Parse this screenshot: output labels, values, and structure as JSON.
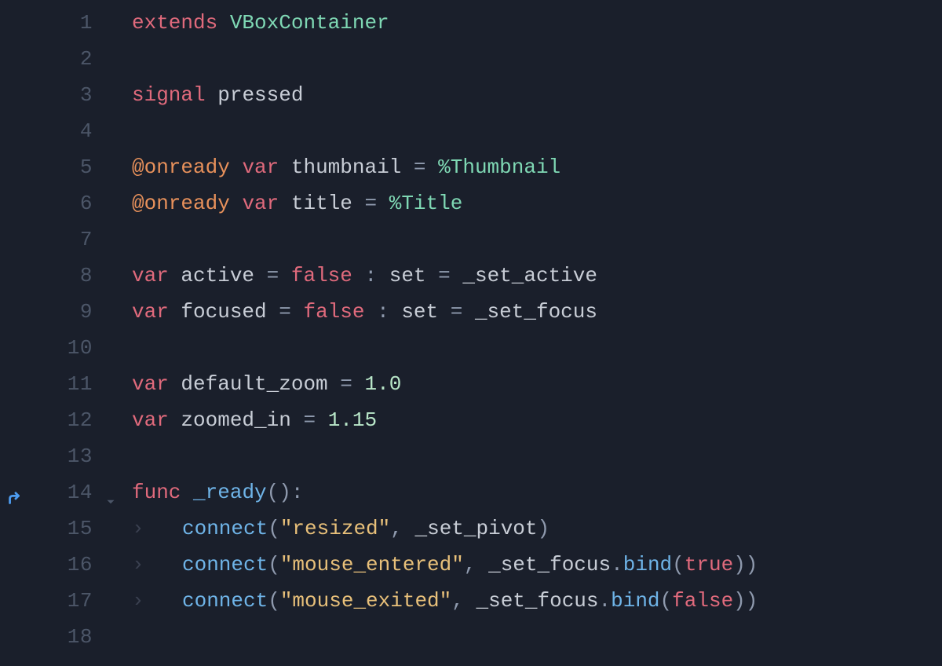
{
  "editor": {
    "language": "gdscript",
    "lines": [
      {
        "num": "1",
        "override": false,
        "fold": false,
        "indent": 0,
        "tokens": [
          {
            "t": "extends",
            "c": "kw1"
          },
          {
            "t": " ",
            "c": ""
          },
          {
            "t": "VBoxContainer",
            "c": "type"
          }
        ]
      },
      {
        "num": "2",
        "override": false,
        "fold": false,
        "indent": 0,
        "tokens": []
      },
      {
        "num": "3",
        "override": false,
        "fold": false,
        "indent": 0,
        "tokens": [
          {
            "t": "signal",
            "c": "kw1"
          },
          {
            "t": " ",
            "c": ""
          },
          {
            "t": "pressed",
            "c": "ident"
          }
        ]
      },
      {
        "num": "4",
        "override": false,
        "fold": false,
        "indent": 0,
        "tokens": []
      },
      {
        "num": "5",
        "override": false,
        "fold": false,
        "indent": 0,
        "tokens": [
          {
            "t": "@onready",
            "c": "kw2"
          },
          {
            "t": " ",
            "c": ""
          },
          {
            "t": "var",
            "c": "kw1"
          },
          {
            "t": " ",
            "c": ""
          },
          {
            "t": "thumbnail",
            "c": "ident"
          },
          {
            "t": " ",
            "c": ""
          },
          {
            "t": "=",
            "c": "op"
          },
          {
            "t": " ",
            "c": ""
          },
          {
            "t": "%",
            "c": "pct"
          },
          {
            "t": "Thumbnail",
            "c": "unique"
          }
        ]
      },
      {
        "num": "6",
        "override": false,
        "fold": false,
        "indent": 0,
        "tokens": [
          {
            "t": "@onready",
            "c": "kw2"
          },
          {
            "t": " ",
            "c": ""
          },
          {
            "t": "var",
            "c": "kw1"
          },
          {
            "t": " ",
            "c": ""
          },
          {
            "t": "title",
            "c": "ident"
          },
          {
            "t": " ",
            "c": ""
          },
          {
            "t": "=",
            "c": "op"
          },
          {
            "t": " ",
            "c": ""
          },
          {
            "t": "%",
            "c": "pct"
          },
          {
            "t": "Title",
            "c": "unique"
          }
        ]
      },
      {
        "num": "7",
        "override": false,
        "fold": false,
        "indent": 0,
        "tokens": []
      },
      {
        "num": "8",
        "override": false,
        "fold": false,
        "indent": 0,
        "tokens": [
          {
            "t": "var",
            "c": "kw1"
          },
          {
            "t": " ",
            "c": ""
          },
          {
            "t": "active",
            "c": "ident"
          },
          {
            "t": " ",
            "c": ""
          },
          {
            "t": "=",
            "c": "op"
          },
          {
            "t": " ",
            "c": ""
          },
          {
            "t": "false",
            "c": "bool"
          },
          {
            "t": " ",
            "c": ""
          },
          {
            "t": ":",
            "c": "op"
          },
          {
            "t": " ",
            "c": ""
          },
          {
            "t": "set",
            "c": "ident"
          },
          {
            "t": " ",
            "c": ""
          },
          {
            "t": "=",
            "c": "op"
          },
          {
            "t": " ",
            "c": ""
          },
          {
            "t": "_set_active",
            "c": "ident"
          }
        ]
      },
      {
        "num": "9",
        "override": false,
        "fold": false,
        "indent": 0,
        "tokens": [
          {
            "t": "var",
            "c": "kw1"
          },
          {
            "t": " ",
            "c": ""
          },
          {
            "t": "focused",
            "c": "ident"
          },
          {
            "t": " ",
            "c": ""
          },
          {
            "t": "=",
            "c": "op"
          },
          {
            "t": " ",
            "c": ""
          },
          {
            "t": "false",
            "c": "bool"
          },
          {
            "t": " ",
            "c": ""
          },
          {
            "t": ":",
            "c": "op"
          },
          {
            "t": " ",
            "c": ""
          },
          {
            "t": "set",
            "c": "ident"
          },
          {
            "t": " ",
            "c": ""
          },
          {
            "t": "=",
            "c": "op"
          },
          {
            "t": " ",
            "c": ""
          },
          {
            "t": "_set_focus",
            "c": "ident"
          }
        ]
      },
      {
        "num": "10",
        "override": false,
        "fold": false,
        "indent": 0,
        "tokens": []
      },
      {
        "num": "11",
        "override": false,
        "fold": false,
        "indent": 0,
        "tokens": [
          {
            "t": "var",
            "c": "kw1"
          },
          {
            "t": " ",
            "c": ""
          },
          {
            "t": "default_zoom",
            "c": "ident"
          },
          {
            "t": " ",
            "c": ""
          },
          {
            "t": "=",
            "c": "op"
          },
          {
            "t": " ",
            "c": ""
          },
          {
            "t": "1.0",
            "c": "num"
          }
        ]
      },
      {
        "num": "12",
        "override": false,
        "fold": false,
        "indent": 0,
        "tokens": [
          {
            "t": "var",
            "c": "kw1"
          },
          {
            "t": " ",
            "c": ""
          },
          {
            "t": "zoomed_in",
            "c": "ident"
          },
          {
            "t": " ",
            "c": ""
          },
          {
            "t": "=",
            "c": "op"
          },
          {
            "t": " ",
            "c": ""
          },
          {
            "t": "1.15",
            "c": "num"
          }
        ]
      },
      {
        "num": "13",
        "override": false,
        "fold": false,
        "indent": 0,
        "tokens": []
      },
      {
        "num": "14",
        "override": true,
        "fold": true,
        "indent": 0,
        "tokens": [
          {
            "t": "func",
            "c": "kw1"
          },
          {
            "t": " ",
            "c": ""
          },
          {
            "t": "_ready",
            "c": "fn"
          },
          {
            "t": "()",
            "c": "punc"
          },
          {
            "t": ":",
            "c": "op"
          }
        ]
      },
      {
        "num": "15",
        "override": false,
        "fold": false,
        "indent": 1,
        "tokens": [
          {
            "t": "connect",
            "c": "fn"
          },
          {
            "t": "(",
            "c": "punc"
          },
          {
            "t": "\"resized\"",
            "c": "str"
          },
          {
            "t": ",",
            "c": "punc"
          },
          {
            "t": " ",
            "c": ""
          },
          {
            "t": "_set_pivot",
            "c": "ident"
          },
          {
            "t": ")",
            "c": "punc"
          }
        ]
      },
      {
        "num": "16",
        "override": false,
        "fold": false,
        "indent": 1,
        "tokens": [
          {
            "t": "connect",
            "c": "fn"
          },
          {
            "t": "(",
            "c": "punc"
          },
          {
            "t": "\"mouse_entered\"",
            "c": "str"
          },
          {
            "t": ",",
            "c": "punc"
          },
          {
            "t": " ",
            "c": ""
          },
          {
            "t": "_set_focus",
            "c": "ident"
          },
          {
            "t": ".",
            "c": "op"
          },
          {
            "t": "bind",
            "c": "fn"
          },
          {
            "t": "(",
            "c": "punc"
          },
          {
            "t": "true",
            "c": "bool"
          },
          {
            "t": ")",
            "c": "punc"
          },
          {
            "t": ")",
            "c": "punc"
          }
        ]
      },
      {
        "num": "17",
        "override": false,
        "fold": false,
        "indent": 1,
        "tokens": [
          {
            "t": "connect",
            "c": "fn"
          },
          {
            "t": "(",
            "c": "punc"
          },
          {
            "t": "\"mouse_exited\"",
            "c": "str"
          },
          {
            "t": ",",
            "c": "punc"
          },
          {
            "t": " ",
            "c": ""
          },
          {
            "t": "_set_focus",
            "c": "ident"
          },
          {
            "t": ".",
            "c": "op"
          },
          {
            "t": "bind",
            "c": "fn"
          },
          {
            "t": "(",
            "c": "punc"
          },
          {
            "t": "false",
            "c": "bool"
          },
          {
            "t": ")",
            "c": "punc"
          },
          {
            "t": ")",
            "c": "punc"
          }
        ]
      },
      {
        "num": "18",
        "override": false,
        "fold": false,
        "indent": 0,
        "tokens": []
      }
    ]
  }
}
